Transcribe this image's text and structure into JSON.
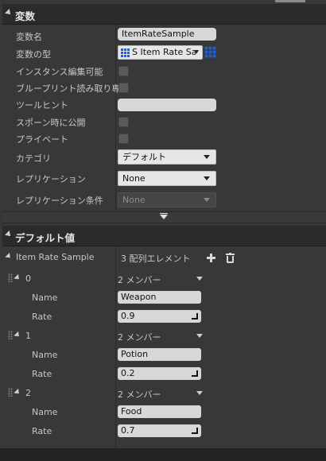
{
  "variable_section": {
    "title": "変数",
    "fields": {
      "name_label": "変数名",
      "name_value": "ItemRateSample",
      "type_label": "変数の型",
      "type_value": "S Item Rate Sam",
      "instance_label": "インスタンス編集可能",
      "blueprint_label": "ブループリント読み取り専",
      "tooltip_label": "ツールヒント",
      "tooltip_value": "",
      "spawn_label": "スポーン時に公開",
      "private_label": "プライベート",
      "category_label": "カテゴリ",
      "category_value": "デフォルト",
      "replication_label": "レプリケーション",
      "replication_value": "None",
      "repcond_label": "レプリケーション条件",
      "repcond_value": "None"
    }
  },
  "default_section": {
    "title": "デフォルト値",
    "array_label": "Item Rate Sample",
    "array_summary": "3 配列エレメント",
    "elements": [
      {
        "index": "0",
        "members": "2 メンバー",
        "name_label": "Name",
        "name_value": "Weapon",
        "rate_label": "Rate",
        "rate_value": "0.9"
      },
      {
        "index": "1",
        "members": "2 メンバー",
        "name_label": "Name",
        "name_value": "Potion",
        "rate_label": "Rate",
        "rate_value": "0.2"
      },
      {
        "index": "2",
        "members": "2 メンバー",
        "name_label": "Name",
        "name_value": "Food",
        "rate_label": "Rate",
        "rate_value": "0.7"
      }
    ]
  }
}
